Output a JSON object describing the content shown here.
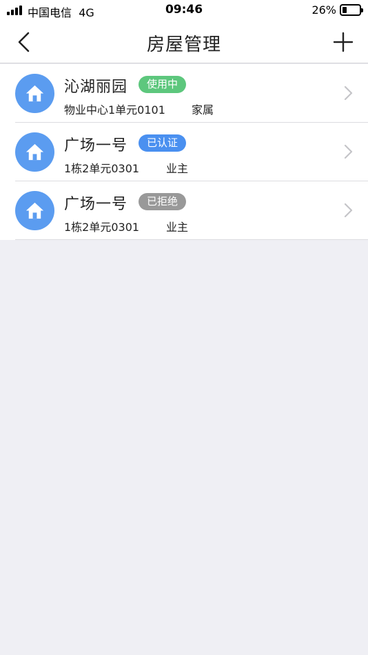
{
  "status_bar": {
    "carrier": "中国电信",
    "network": "4G",
    "time": "09:46",
    "battery": "26%",
    "battery_level": 0.26
  },
  "nav": {
    "title": "房屋管理",
    "back_icon": "chevron-left-icon",
    "add_icon": "plus-icon"
  },
  "houses": [
    {
      "name": "沁湖丽园",
      "status": "使用中",
      "status_color": "#5dc77d",
      "address": "物业中心1单元0101",
      "role": "家属"
    },
    {
      "name": "广场一号",
      "status": "已认证",
      "status_color": "#4a90f0",
      "address": "1栋2单元0301",
      "role": "业主"
    },
    {
      "name": "广场一号",
      "status": "已拒绝",
      "status_color": "#999999",
      "address": "1栋2单元0301",
      "role": "业主"
    }
  ]
}
